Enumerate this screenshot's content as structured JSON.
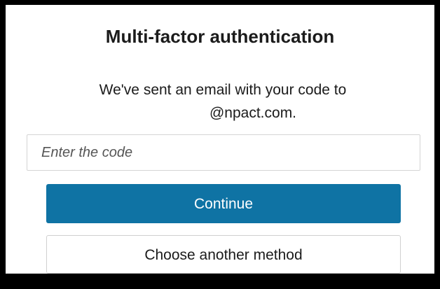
{
  "dialog": {
    "title": "Multi-factor authentication",
    "message_line1": "We've sent an email with your code to",
    "message_line2": "@npact.com."
  },
  "code_input": {
    "placeholder": "Enter the code",
    "value": ""
  },
  "buttons": {
    "continue_label": "Continue",
    "another_method_label": "Choose another method"
  },
  "colors": {
    "primary_button": "#0f73a4",
    "border": "#000000"
  }
}
